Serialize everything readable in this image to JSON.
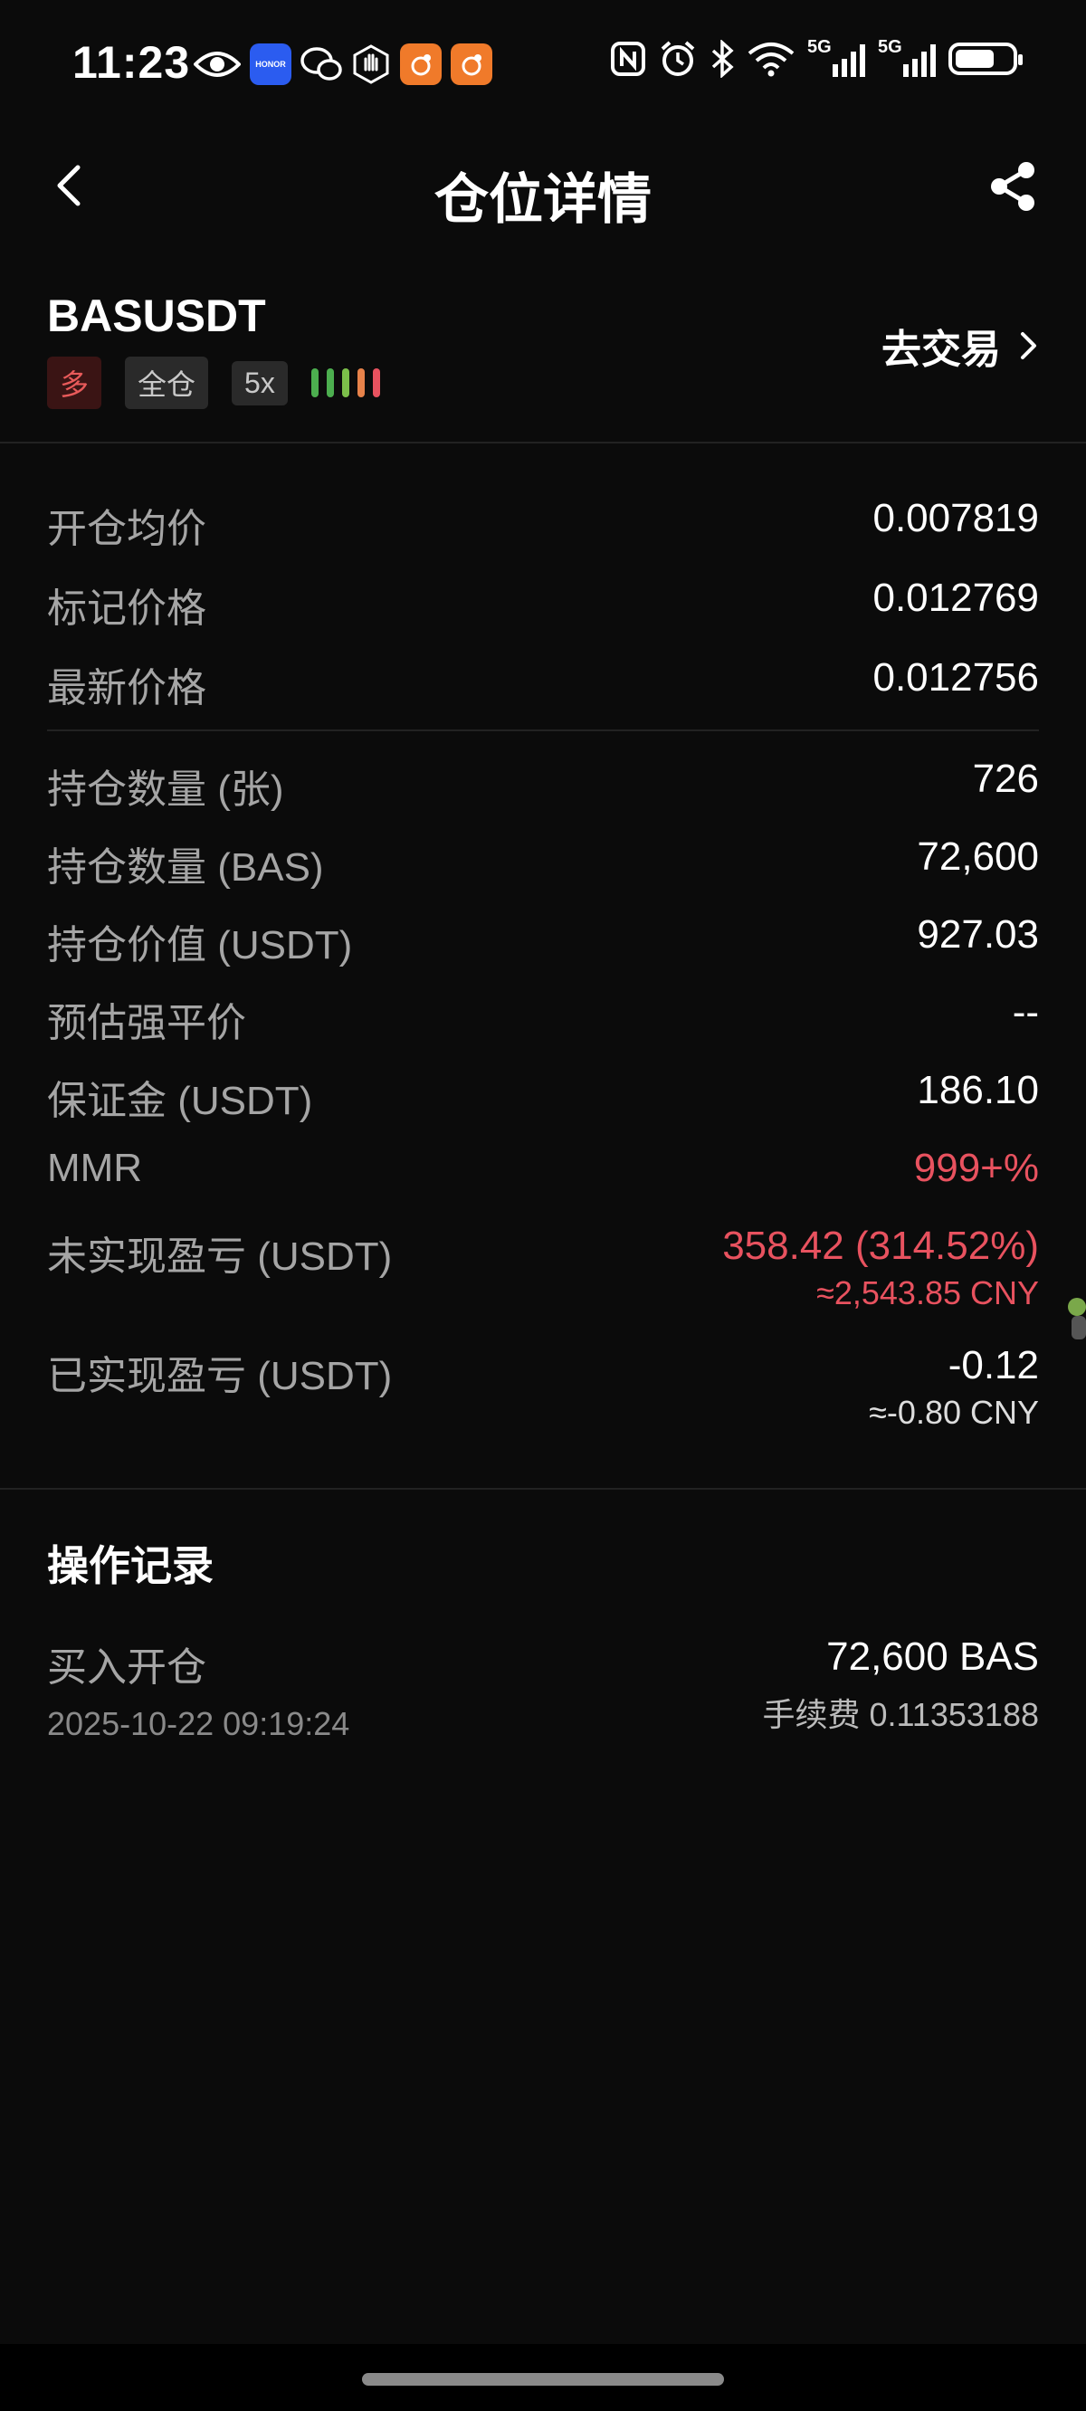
{
  "status_bar": {
    "time": "11:23",
    "left_icons": [
      "eye-icon",
      "honor-app-icon",
      "wechat-icon",
      "hand-icon",
      "app-orange-icon",
      "app-orange-icon"
    ],
    "right_icons": [
      "nfc-icon",
      "alarm-icon",
      "bluetooth-icon",
      "wifi-icon",
      "signal-5g-icon",
      "signal-5g-icon",
      "battery-icon"
    ],
    "honor_label": "HONOR",
    "net1": "5G",
    "net2": "5G",
    "battery_level": 0.7
  },
  "nav": {
    "title": "仓位详情",
    "back_icon": "chevron-left-icon",
    "share_icon": "share-icon"
  },
  "position": {
    "symbol": "BASUSDT",
    "side_tag": "多",
    "margin_mode_tag": "全仓",
    "leverage_tag": "5x",
    "risk_bars": [
      "#4cae4f",
      "#4cae4f",
      "#7cbf4a",
      "#e7824a",
      "#e8525f"
    ],
    "trade_link": "去交易"
  },
  "price_rows": [
    {
      "label": "开仓均价",
      "value": "0.007819"
    },
    {
      "label": "标记价格",
      "value": "0.012769"
    },
    {
      "label": "最新价格",
      "value": "0.012756"
    }
  ],
  "detail_rows": [
    {
      "label": "持仓数量 (张)",
      "value": "726"
    },
    {
      "label": "持仓数量 (BAS)",
      "value": "72,600"
    },
    {
      "label": "持仓价值 (USDT)",
      "value": "927.03"
    },
    {
      "label": "预估强平价",
      "value": "--"
    },
    {
      "label": "保证金 (USDT)",
      "value": "186.10"
    },
    {
      "label": "MMR",
      "value": "999+%"
    },
    {
      "label": "未实现盈亏 (USDT)",
      "value": "358.42 (314.52%)",
      "sub": "≈2,543.85 CNY"
    },
    {
      "label": "已实现盈亏 (USDT)",
      "value": "-0.12",
      "sub": "≈-0.80 CNY"
    }
  ],
  "records": {
    "title": "操作记录",
    "items": [
      {
        "action": "买入开仓",
        "time": "2025-10-22 09:19:24",
        "amount": "72,600 BAS",
        "fee": "手续费 0.11353188"
      }
    ]
  },
  "colors": {
    "profit_red": "#e8525f",
    "background": "#0b0b0b"
  }
}
